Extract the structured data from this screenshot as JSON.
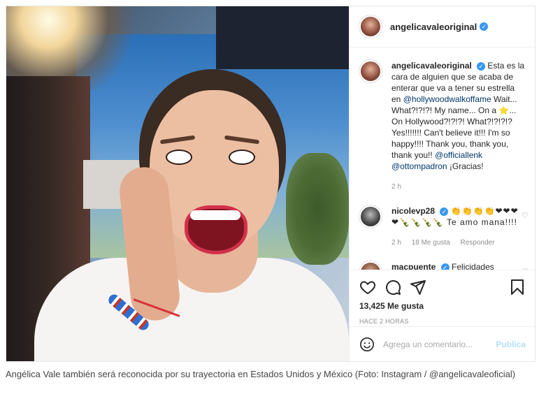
{
  "post": {
    "username": "angelicavaleoriginal",
    "caption_text_1": "Esta es la cara de alguien que se acaba de enterar que va a tener su estrella en ",
    "caption_mention_1": "@hollywoodwalkoffame",
    "caption_text_2": " Wait... What?!?!?! My name... On a ⭐... On Hollywood?!?!?! What?!?!?!? Yes!!!!!!! Can't believe it!!! I'm so happy!!!! Thank you, thank you, thank you!! ",
    "caption_mention_2": "@officiallenk",
    "caption_mention_3": "@ottompadron",
    "caption_text_3": "¡Gracias!",
    "caption_age": "2 h",
    "likes": "13,425 Me gusta",
    "posted_ago": "HACE 2 HORAS"
  },
  "comments": [
    {
      "username": "nicolevp28",
      "text": "👏👏👏👏❤❤❤❤🍾🍾🍾🍾 Te amo mana!!!!",
      "age": "2 h",
      "likes": "18 Me gusta",
      "reply": "Responder"
    },
    {
      "username": "macpuente",
      "text": "Felicidades"
    }
  ],
  "add_comment": {
    "placeholder": "Agrega un comentario...",
    "post_label": "Publica"
  },
  "article_caption": "Angélica Vale también será reconocida por su trayectoria en Estados Unidos y México (Foto: Instagram / @angelicavaleoficial)",
  "colors": {
    "verified": "#3897f0",
    "mention": "#00376b",
    "muted": "#8e8e8e"
  }
}
